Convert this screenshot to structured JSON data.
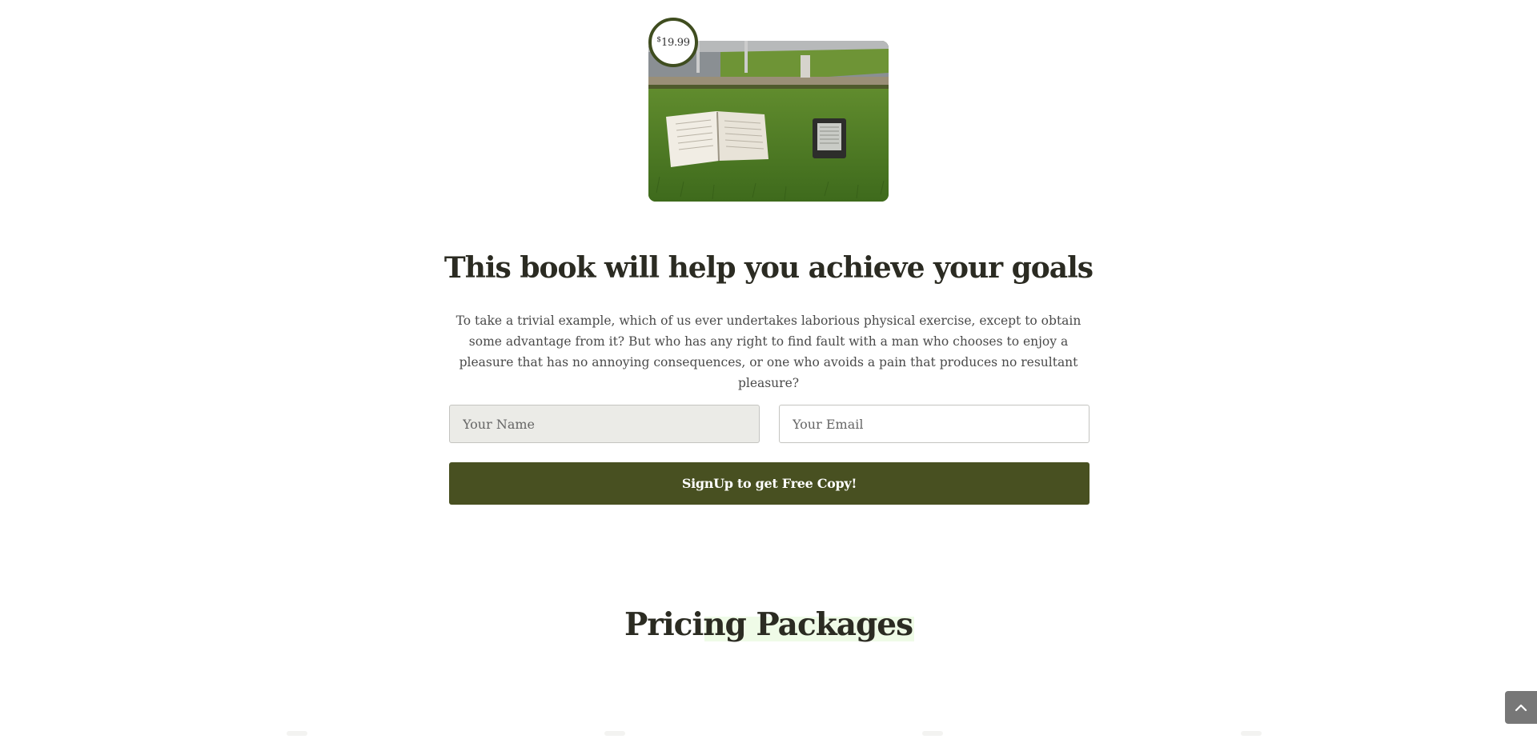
{
  "hero": {
    "price_currency": "$",
    "price_amount": "19.99",
    "image_icon": "book-and-ereader-on-grass-photo"
  },
  "headline": "This book will help you achieve your goals",
  "lead_text": "To take a trivial example, which of us ever undertakes laborious physical exercise, except to obtain some advantage from it? But who has any right to find fault with a man who chooses to enjoy a pleasure that has no annoying consequences, or one who avoids a pain that produces no resultant pleasure?",
  "form": {
    "name_placeholder": "Your Name",
    "email_placeholder": "Your Email",
    "submit_label": "SignUp to get Free Copy!"
  },
  "pricing": {
    "title": "Pricing Packages"
  },
  "scroll_top": {
    "icon": "chevron-up-icon"
  },
  "colors": {
    "accent": "#485021",
    "badge_border": "#3f4d1f",
    "heading": "#2b2b22",
    "highlight": "#effbe7"
  }
}
